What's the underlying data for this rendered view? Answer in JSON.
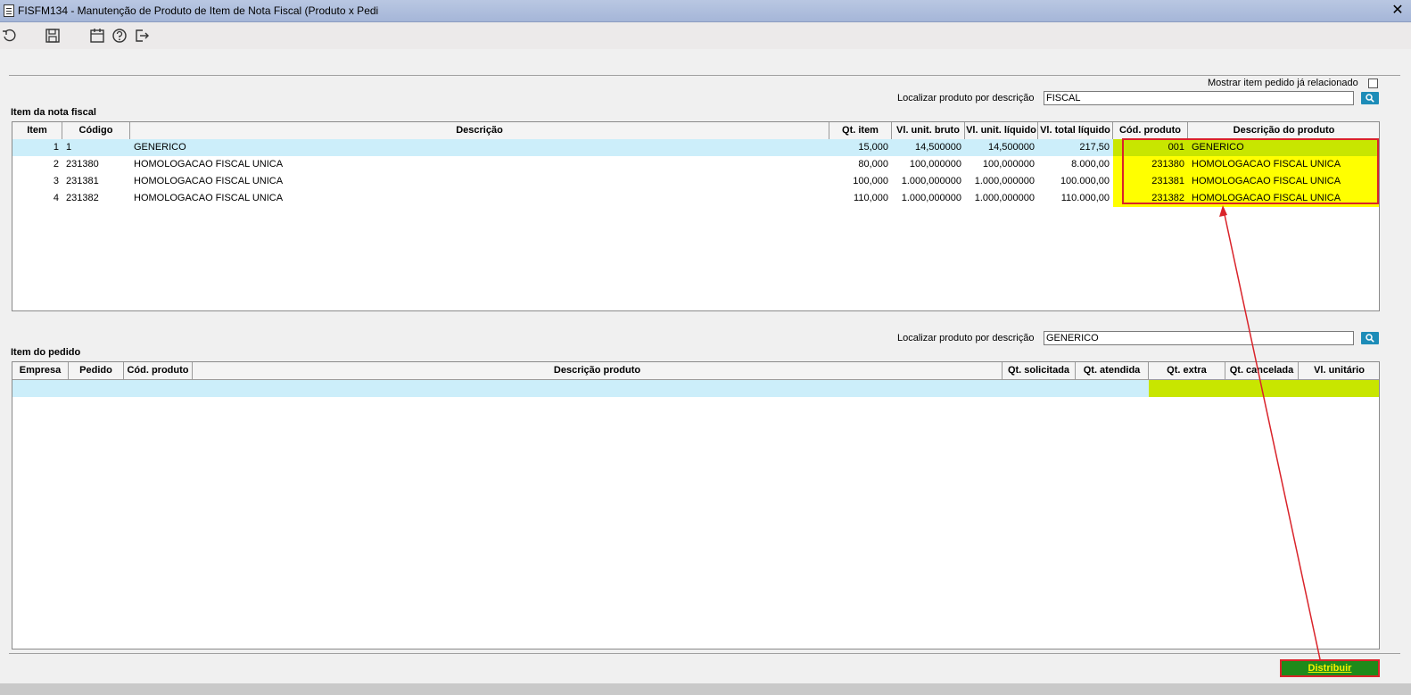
{
  "window": {
    "title": "FISFM134 - Manutenção de Produto de Item de Nota Fiscal (Produto x Pedi",
    "close_glyph": "✕"
  },
  "toolbar": {
    "icons": [
      "undo-icon",
      "save-icon",
      "calendar-icon",
      "help-icon",
      "exit-icon"
    ]
  },
  "top": {
    "show_related_label": "Mostrar item pedido já relacionado",
    "search_label": "Localizar produto por descrição",
    "search_value": "FISCAL",
    "section_title": "Item da nota fiscal",
    "columns": [
      "Item",
      "Código",
      "Descrição",
      "Qt. item",
      "Vl. unit. bruto",
      "Vl. unit. líquido",
      "Vl. total líquido",
      "Cód. produto",
      "Descrição do produto"
    ],
    "rows": [
      {
        "item": "1",
        "codigo": "1",
        "descricao": "GENERICO",
        "qt": "15,000",
        "bruto": "14,500000",
        "liquido": "14,500000",
        "total": "217,50",
        "cod_produto": "001",
        "desc_produto": "GENERICO"
      },
      {
        "item": "2",
        "codigo": "231380",
        "descricao": "HOMOLOGACAO FISCAL UNICA",
        "qt": "80,000",
        "bruto": "100,000000",
        "liquido": "100,000000",
        "total": "8.000,00",
        "cod_produto": "231380",
        "desc_produto": "HOMOLOGACAO FISCAL UNICA"
      },
      {
        "item": "3",
        "codigo": "231381",
        "descricao": "HOMOLOGACAO FISCAL UNICA",
        "qt": "100,000",
        "bruto": "1.000,000000",
        "liquido": "1.000,000000",
        "total": "100.000,00",
        "cod_produto": "231381",
        "desc_produto": "HOMOLOGACAO FISCAL UNICA"
      },
      {
        "item": "4",
        "codigo": "231382",
        "descricao": "HOMOLOGACAO FISCAL UNICA",
        "qt": "110,000",
        "bruto": "1.000,000000",
        "liquido": "1.000,000000",
        "total": "110.000,00",
        "cod_produto": "231382",
        "desc_produto": "HOMOLOGACAO FISCAL UNICA"
      }
    ]
  },
  "bottom": {
    "search_label": "Localizar produto por descrição",
    "search_value": "GENERICO",
    "section_title": "Item do pedido",
    "columns": [
      "Empresa",
      "Pedido",
      "Cód. produto",
      "Descrição produto",
      "Qt. solicitada",
      "Qt. atendida",
      "Qt. extra",
      "Qt. cancelada",
      "Vl. unitário"
    ]
  },
  "actions": {
    "distribute_label": "Distribuir"
  },
  "colors": {
    "selected_row": "#cceefa",
    "highlight_yellow": "#ffff00",
    "highlight_lime": "#c8e600",
    "annotation_red": "#d9232a",
    "button_green": "#1f8a1a"
  }
}
